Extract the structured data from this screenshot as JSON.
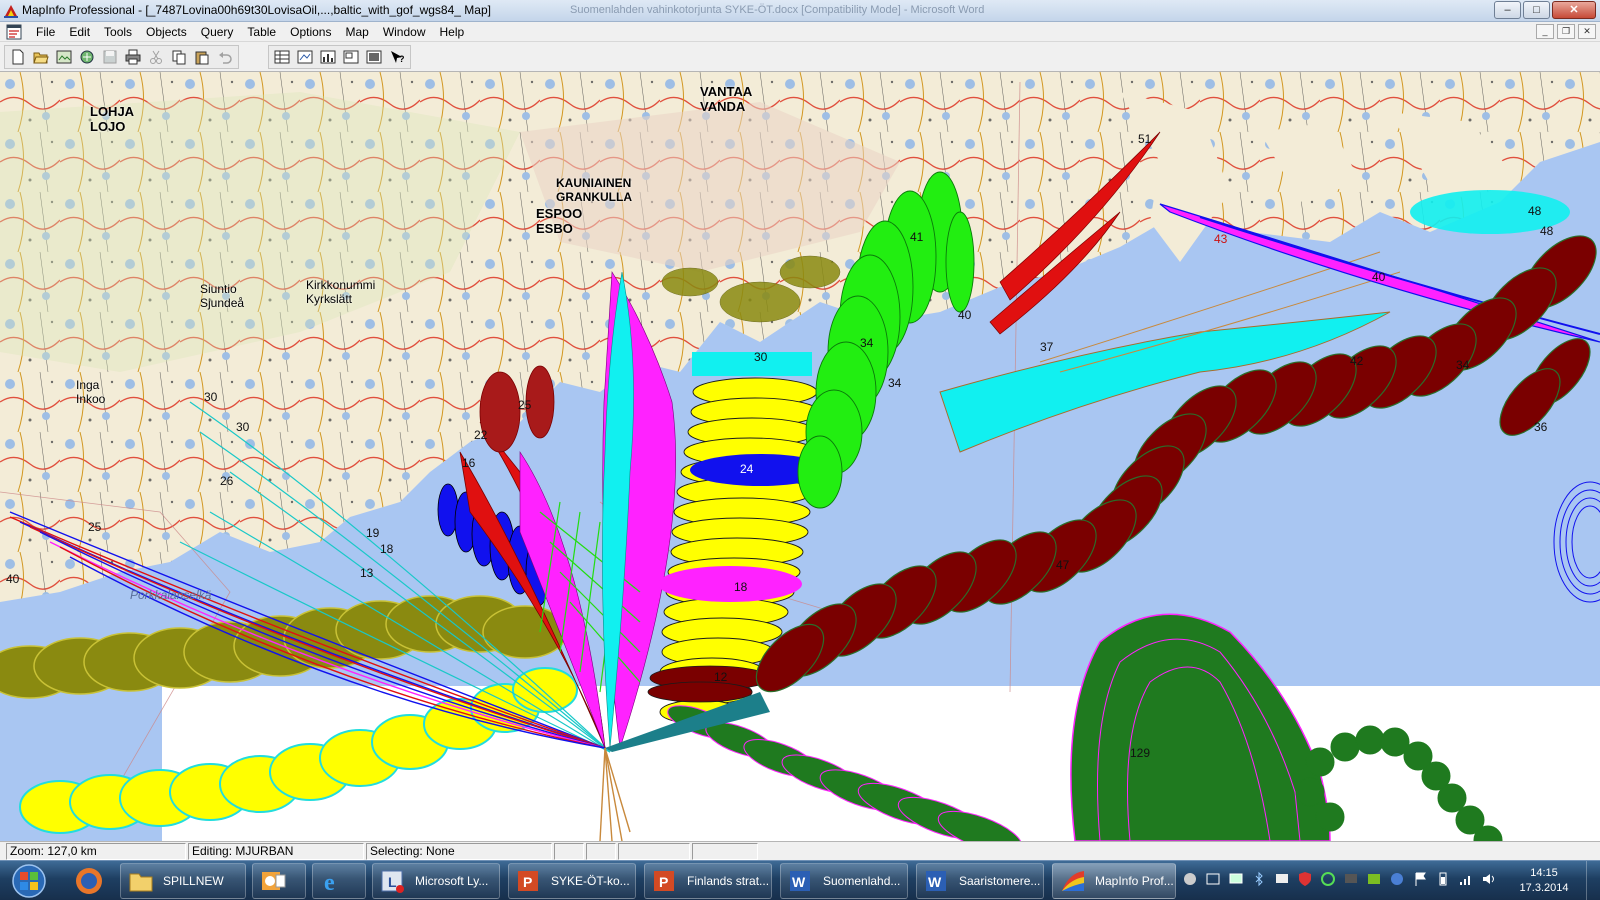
{
  "window": {
    "title": "MapInfo Professional - [_7487Lovina00h69t30LovisaOil,...,baltic_with_gof_wgs84_ Map]",
    "ghost_title": "Suomenlahden vahinkotorjunta SYKE-ÖT.docx [Compatibility Mode] - Microsoft Word",
    "buttons": {
      "minimize": "–",
      "maximize": "□",
      "close": "✕"
    }
  },
  "menubar": {
    "items": [
      "File",
      "Edit",
      "Tools",
      "Objects",
      "Query",
      "Table",
      "Options",
      "Map",
      "Window",
      "Help"
    ],
    "mdi": {
      "minimize": "_",
      "restore": "❐",
      "close": "✕"
    }
  },
  "toolbar": {
    "buttons": [
      "new-icon",
      "open-icon",
      "open-workspace-icon",
      "open-dbms-icon",
      "save-icon",
      "print-icon",
      "cut-icon",
      "copy-icon",
      "paste-icon",
      "undo-icon",
      "new-browser-icon",
      "new-mapper-icon",
      "new-grapher-icon",
      "new-layout-icon",
      "new-redistrict-icon",
      "help-pointer-icon"
    ]
  },
  "map": {
    "places": [
      {
        "name": "LOHJA",
        "alt": "LOJO"
      },
      {
        "name": "VANTAA",
        "alt": "VANDA"
      },
      {
        "name": "KAUNIAINEN",
        "alt": "GRANKULLA"
      },
      {
        "name": "ESPOO",
        "alt": "ESBO"
      },
      {
        "name": "Siuntio",
        "alt": "Sjundeå"
      },
      {
        "name": "Kirkkonummi",
        "alt": "Kyrkslätt"
      },
      {
        "name": "Inga",
        "alt": "Inkoo"
      },
      {
        "name": "Porkkalanselkä",
        "alt": ""
      }
    ],
    "labels": [
      "30",
      "30",
      "30",
      "34",
      "34",
      "37",
      "40",
      "41",
      "48",
      "48",
      "40",
      "43",
      "42",
      "34",
      "36",
      "25",
      "22",
      "16",
      "26",
      "19",
      "18",
      "13",
      "25",
      "40",
      "24",
      "18",
      "12",
      "129",
      "47",
      "51"
    ],
    "colors": {
      "sea": "#a9c6f2",
      "land": "#f3ecd7",
      "red": "#e01010",
      "magenta": "#ff22ff",
      "yellow": "#ffff00",
      "green": "#22ee11",
      "cyan": "#11f0f0",
      "blue": "#1111ee",
      "darkred": "#7a0000",
      "olive": "#8a8a10",
      "darkgreen": "#1f7a1f",
      "teal": "#1c7f8a"
    }
  },
  "statusbar": {
    "zoom": "Zoom: 127,0 km",
    "editing": "Editing: MJURBAN",
    "selecting": "Selecting: None"
  },
  "taskbar": {
    "tasks": [
      {
        "label": "SPILLNEW",
        "icon": "folder-icon"
      },
      {
        "label": "",
        "icon": "outlook-icon"
      },
      {
        "label": "",
        "icon": "ie-icon"
      },
      {
        "label": "Microsoft Ly...",
        "icon": "lync-icon"
      },
      {
        "label": "SYKE-ÖT-ko...",
        "icon": "powerpoint-icon"
      },
      {
        "label": "Finlands strat...",
        "icon": "powerpoint-icon"
      },
      {
        "label": "Suomenlahd...",
        "icon": "word-icon"
      },
      {
        "label": "Saaristomere...",
        "icon": "word-icon"
      },
      {
        "label": "MapInfo Prof...",
        "icon": "mapinfo-icon"
      }
    ],
    "clock": {
      "time": "14:15",
      "date": "17.3.2014"
    }
  }
}
